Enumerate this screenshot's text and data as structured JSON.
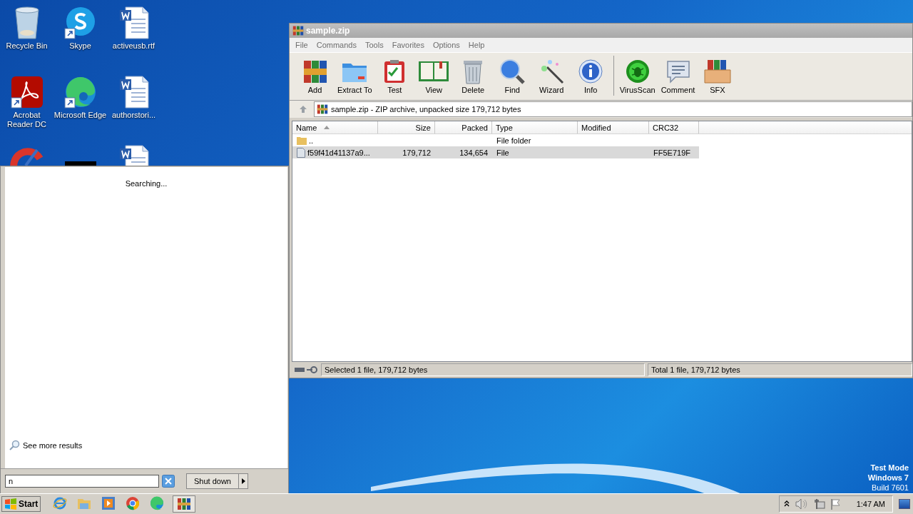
{
  "desktop_icons": [
    {
      "label": "Recycle Bin",
      "kind": "recycle"
    },
    {
      "label": "Skype",
      "kind": "skype"
    },
    {
      "label": "activeusb.rtf",
      "kind": "word"
    },
    {
      "label": "Acrobat Reader DC",
      "kind": "acrobat"
    },
    {
      "label": "Microsoft Edge",
      "kind": "edge"
    },
    {
      "label": "authorstori...",
      "kind": "word"
    },
    {
      "kind": "ccleaner"
    },
    {
      "kind": "dark"
    },
    {
      "kind": "word"
    }
  ],
  "winrar": {
    "title": "sample.zip",
    "menu": [
      "File",
      "Commands",
      "Tools",
      "Favorites",
      "Options",
      "Help"
    ],
    "toolbar": [
      {
        "label": "Add",
        "kind": "add"
      },
      {
        "label": "Extract To",
        "kind": "extract"
      },
      {
        "label": "Test",
        "kind": "test"
      },
      {
        "label": "View",
        "kind": "view"
      },
      {
        "label": "Delete",
        "kind": "delete"
      },
      {
        "label": "Find",
        "kind": "find"
      },
      {
        "label": "Wizard",
        "kind": "wizard"
      },
      {
        "label": "Info",
        "kind": "info"
      },
      {
        "label": "VirusScan",
        "kind": "virus",
        "group_start": true
      },
      {
        "label": "Comment",
        "kind": "comment"
      },
      {
        "label": "SFX",
        "kind": "sfx"
      }
    ],
    "address": "sample.zip - ZIP archive, unpacked size 179,712 bytes",
    "columns": [
      {
        "label": "Name",
        "sorted": true
      },
      {
        "label": "Size",
        "sorted": false
      },
      {
        "label": "Packed",
        "sorted": false
      },
      {
        "label": "Type",
        "sorted": false
      },
      {
        "label": "Modified",
        "sorted": false
      },
      {
        "label": "CRC32",
        "sorted": false
      }
    ],
    "rows": [
      {
        "kind": "folder",
        "name": "..",
        "type": "File folder",
        "selected": false
      },
      {
        "kind": "file",
        "name": "f59f41d41137a9...",
        "size": "179,712",
        "packed": "134,654",
        "type": "File",
        "crc32": "FF5E719F",
        "selected": true
      }
    ],
    "status_left": "Selected 1 file, 179,712 bytes",
    "status_right": "Total 1 file, 179,712 bytes"
  },
  "start_menu": {
    "status": "Searching...",
    "more_results": "See more results",
    "search_value": "n",
    "shutdown": "Shut down"
  },
  "watermark_text": [
    {
      "text": "Test Mode",
      "bold": true
    },
    {
      "text": "Windows 7",
      "bold": true
    },
    {
      "text": "Build 7601",
      "bold": false
    }
  ],
  "taskbar": {
    "start": "Start",
    "apps": [
      {
        "kind": "ie",
        "active": false
      },
      {
        "kind": "explorer",
        "active": false
      },
      {
        "kind": "media",
        "active": false
      },
      {
        "kind": "chrome",
        "active": false
      },
      {
        "kind": "edge",
        "active": false
      },
      {
        "kind": "winrar",
        "active": true
      }
    ],
    "clock": "1:47 AM"
  }
}
